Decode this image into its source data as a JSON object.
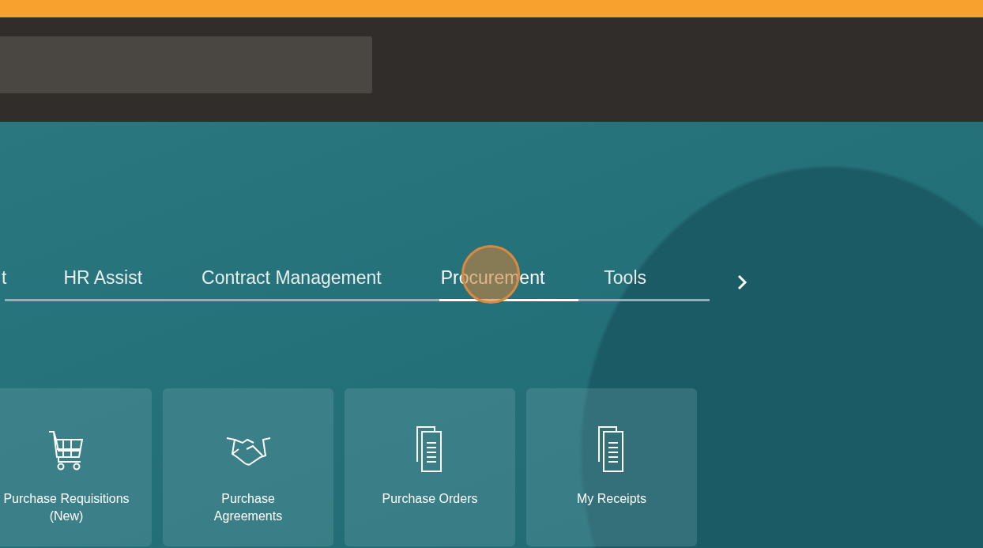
{
  "tabs": [
    {
      "label": "t",
      "selected": false
    },
    {
      "label": "HR Assist",
      "selected": false
    },
    {
      "label": "Contract Management",
      "selected": false
    },
    {
      "label": "Procurement",
      "selected": true
    },
    {
      "label": "Tools",
      "selected": false
    }
  ],
  "tiles": [
    {
      "label": "Purchase Requisitions (New)",
      "kind": "cart"
    },
    {
      "label": "Purchase Agreements",
      "kind": "handshake"
    },
    {
      "label": "Purchase Orders",
      "kind": "documents"
    },
    {
      "label": "My Receipts",
      "kind": "documents"
    }
  ]
}
